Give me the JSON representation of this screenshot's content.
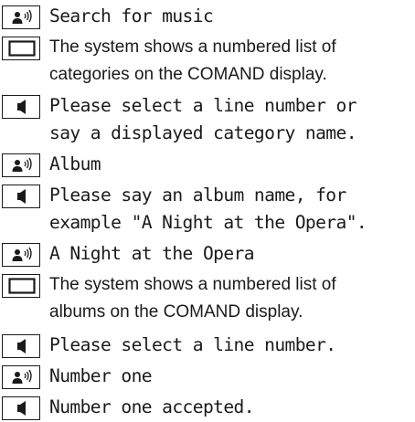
{
  "dialog": [
    {
      "kind": "user",
      "icon": "speak-icon",
      "lines": [
        "Search for music"
      ]
    },
    {
      "kind": "display",
      "icon": "display-icon",
      "lines": [
        "The system shows a numbered list of",
        "categories on the COMAND display."
      ]
    },
    {
      "kind": "system",
      "icon": "speaker-icon",
      "lines": [
        "Please select a line number or",
        "say a displayed category name."
      ]
    },
    {
      "kind": "user",
      "icon": "speak-icon",
      "lines": [
        "Album"
      ]
    },
    {
      "kind": "system",
      "icon": "speaker-icon",
      "lines": [
        "Please say an album name, for",
        "example \"A Night at the Opera\"."
      ]
    },
    {
      "kind": "user",
      "icon": "speak-icon",
      "lines": [
        "A Night at the Opera"
      ]
    },
    {
      "kind": "display",
      "icon": "display-icon",
      "lines": [
        "The system shows a numbered list of",
        "albums on the COMAND display."
      ]
    },
    {
      "kind": "system",
      "icon": "speaker-icon",
      "lines": [
        "Please select a line number."
      ]
    },
    {
      "kind": "user",
      "icon": "speak-icon",
      "lines": [
        "Number one"
      ]
    },
    {
      "kind": "system",
      "icon": "speaker-icon",
      "lines": [
        "Number one accepted."
      ]
    }
  ]
}
